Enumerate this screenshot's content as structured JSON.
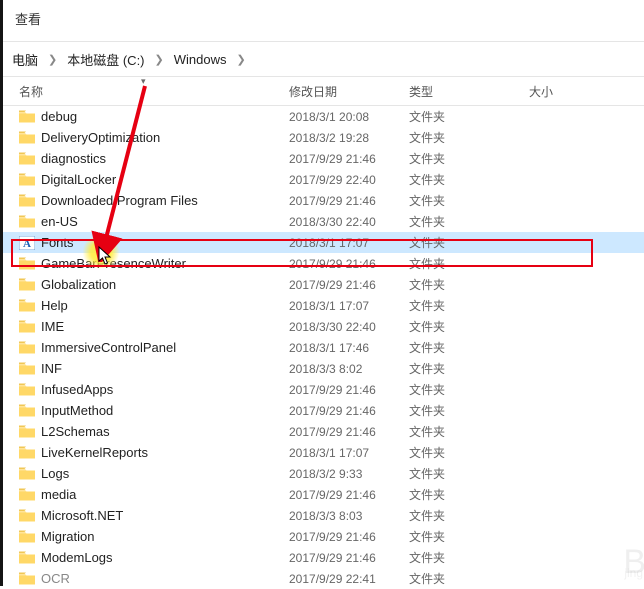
{
  "topbar": {
    "view": "查看"
  },
  "breadcrumbs": {
    "parts": [
      "电脑",
      "本地磁盘 (C:)",
      "Windows"
    ]
  },
  "columns": {
    "name": "名称",
    "date": "修改日期",
    "type": "类型",
    "size": "大小"
  },
  "type_folder": "文件夹",
  "rows": [
    {
      "name": "debug",
      "date": "2018/3/1 20:08",
      "type": "文件夹",
      "icon": "folder"
    },
    {
      "name": "DeliveryOptimization",
      "date": "2018/3/2 19:28",
      "type": "文件夹",
      "icon": "folder"
    },
    {
      "name": "diagnostics",
      "date": "2017/9/29 21:46",
      "type": "文件夹",
      "icon": "folder"
    },
    {
      "name": "DigitalLocker",
      "date": "2017/9/29 22:40",
      "type": "文件夹",
      "icon": "folder"
    },
    {
      "name": "Downloaded Program Files",
      "date": "2017/9/29 21:46",
      "type": "文件夹",
      "icon": "folder"
    },
    {
      "name": "en-US",
      "date": "2018/3/30 22:40",
      "type": "文件夹",
      "icon": "folder"
    },
    {
      "name": "Fonts",
      "date": "2018/3/1 17:07",
      "type": "文件夹",
      "icon": "fontfolder",
      "selected": true
    },
    {
      "name": "GameBarPresenceWriter",
      "date": "2017/9/29 21:46",
      "type": "文件夹",
      "icon": "folder"
    },
    {
      "name": "Globalization",
      "date": "2017/9/29 21:46",
      "type": "文件夹",
      "icon": "folder"
    },
    {
      "name": "Help",
      "date": "2018/3/1 17:07",
      "type": "文件夹",
      "icon": "folder"
    },
    {
      "name": "IME",
      "date": "2018/3/30 22:40",
      "type": "文件夹",
      "icon": "folder"
    },
    {
      "name": "ImmersiveControlPanel",
      "date": "2018/3/1 17:46",
      "type": "文件夹",
      "icon": "folder"
    },
    {
      "name": "INF",
      "date": "2018/3/3 8:02",
      "type": "文件夹",
      "icon": "folder"
    },
    {
      "name": "InfusedApps",
      "date": "2017/9/29 21:46",
      "type": "文件夹",
      "icon": "folder"
    },
    {
      "name": "InputMethod",
      "date": "2017/9/29 21:46",
      "type": "文件夹",
      "icon": "folder"
    },
    {
      "name": "L2Schemas",
      "date": "2017/9/29 21:46",
      "type": "文件夹",
      "icon": "folder"
    },
    {
      "name": "LiveKernelReports",
      "date": "2018/3/1 17:07",
      "type": "文件夹",
      "icon": "folder"
    },
    {
      "name": "Logs",
      "date": "2018/3/2 9:33",
      "type": "文件夹",
      "icon": "folder"
    },
    {
      "name": "media",
      "date": "2017/9/29 21:46",
      "type": "文件夹",
      "icon": "folder"
    },
    {
      "name": "Microsoft.NET",
      "date": "2018/3/3 8:03",
      "type": "文件夹",
      "icon": "folder"
    },
    {
      "name": "Migration",
      "date": "2017/9/29 21:46",
      "type": "文件夹",
      "icon": "folder"
    },
    {
      "name": "ModemLogs",
      "date": "2017/9/29 21:46",
      "type": "文件夹",
      "icon": "folder"
    },
    {
      "name": "OCR",
      "date": "2017/9/29 22:41",
      "type": "文件夹",
      "icon": "folder",
      "cut": true
    }
  ]
}
